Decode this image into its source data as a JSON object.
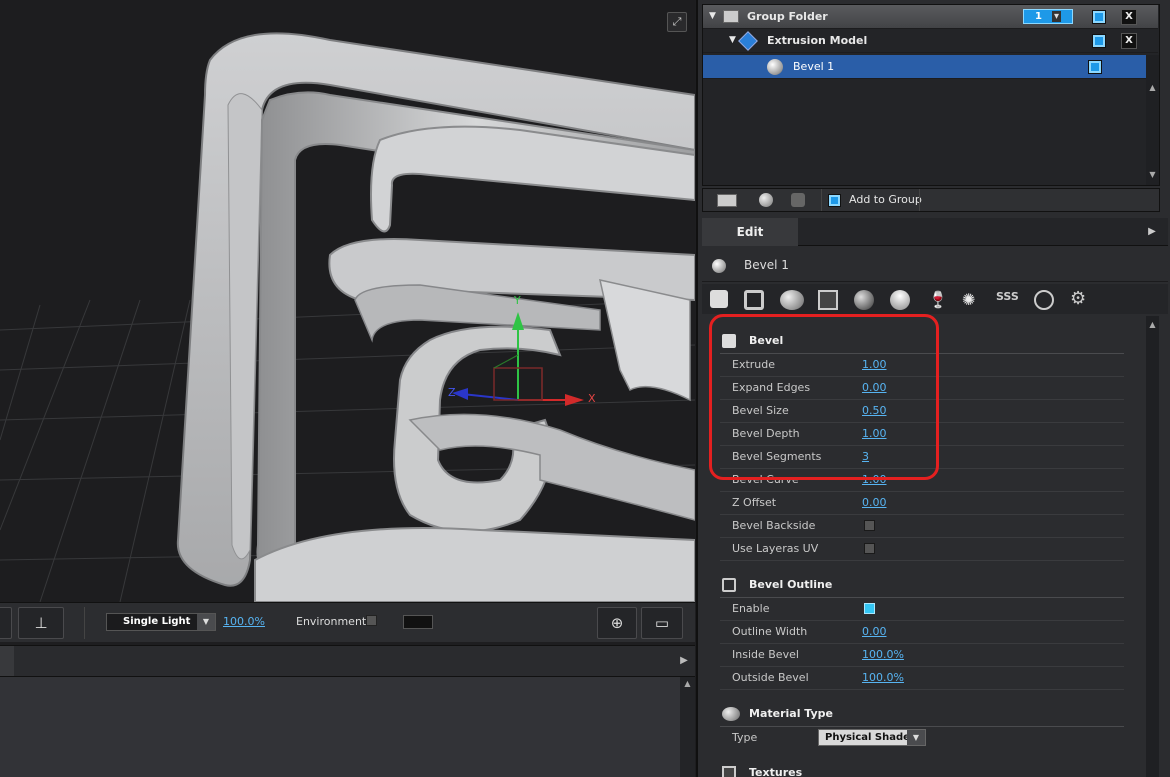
{
  "viewport": {
    "axis_x": "X",
    "axis_y": "Y",
    "axis_z": "Z",
    "expand_icon": "expand-icon"
  },
  "toolbar": {
    "light_mode": "Single Light",
    "light_percent": "100.0%",
    "environment_label": "Environment"
  },
  "tree": {
    "group_folder": "Group Folder",
    "group_count": "1",
    "extrusion_model": "Extrusion Model",
    "bevel": "Bevel 1",
    "close": "X",
    "add_to_group": "Add to Group"
  },
  "edit": {
    "tab_label": "Edit",
    "object_name": "Bevel 1"
  },
  "bevel_section": {
    "title": "Bevel",
    "props": [
      {
        "label": "Extrude",
        "value": "1.00"
      },
      {
        "label": "Expand Edges",
        "value": "0.00"
      },
      {
        "label": "Bevel Size",
        "value": "0.50"
      },
      {
        "label": "Bevel Depth",
        "value": "1.00"
      },
      {
        "label": "Bevel Segments",
        "value": "3"
      },
      {
        "label": "Bevel Curve",
        "value": "1.00"
      },
      {
        "label": "Z Offset",
        "value": "0.00"
      },
      {
        "label": "Bevel Backside",
        "value": ""
      },
      {
        "label": "Use Layeras UV",
        "value": ""
      }
    ]
  },
  "outline_section": {
    "title": "Bevel Outline",
    "props": [
      {
        "label": "Enable",
        "value": ""
      },
      {
        "label": "Outline Width",
        "value": "0.00"
      },
      {
        "label": "Inside Bevel",
        "value": "100.0%"
      },
      {
        "label": "Outside Bevel",
        "value": "100.0%"
      }
    ]
  },
  "material_section": {
    "title": "Material Type",
    "type_label": "Type",
    "type_value": "Physical Shader"
  },
  "textures_section": {
    "title": "Textures"
  },
  "colors": {
    "accent": "#1e99e8",
    "selection": "#2a5ea8",
    "highlight_ring": "#e42020",
    "link": "#57b4f2"
  }
}
